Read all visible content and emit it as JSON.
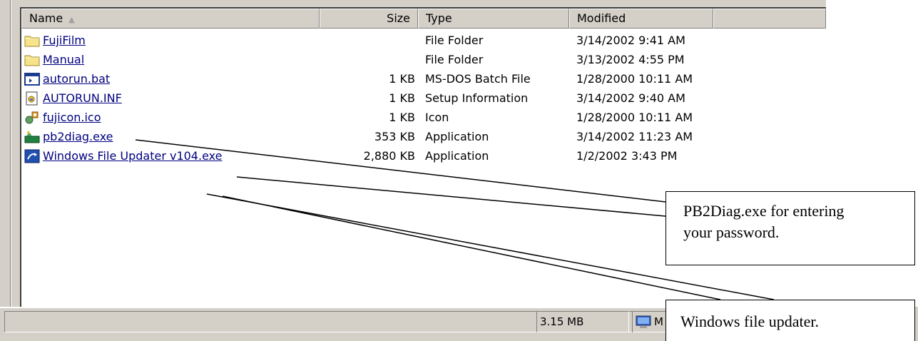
{
  "columns": {
    "name": "Name",
    "size": "Size",
    "type": "Type",
    "modified": "Modified"
  },
  "files": [
    {
      "icon": "folder-icon",
      "name": "FujiFilm",
      "size": "",
      "type": "File Folder",
      "modified": "3/14/2002 9:41 AM"
    },
    {
      "icon": "folder-icon",
      "name": "Manual",
      "size": "",
      "type": "File Folder",
      "modified": "3/13/2002 4:55 PM"
    },
    {
      "icon": "batch-file-icon",
      "name": "autorun.bat",
      "size": "1 KB",
      "type": "MS-DOS Batch File",
      "modified": "1/28/2000 10:11 AM"
    },
    {
      "icon": "setup-info-icon",
      "name": "AUTORUN.INF",
      "size": "1 KB",
      "type": "Setup Information",
      "modified": "3/14/2002 9:40 AM"
    },
    {
      "icon": "icon-file-icon",
      "name": "fujicon.ico",
      "size": "1 KB",
      "type": "Icon",
      "modified": "1/28/2000 10:11 AM"
    },
    {
      "icon": "application-icon",
      "name": "pb2diag.exe",
      "size": "353 KB",
      "type": "Application",
      "modified": "3/14/2002 11:23 AM"
    },
    {
      "icon": "updater-app-icon",
      "name": "Windows File Updater v104.exe",
      "size": "2,880 KB",
      "type": "Application",
      "modified": "1/2/2002 3:43 PM"
    }
  ],
  "status": {
    "total_size": "3.15 MB",
    "zone_text": "M"
  },
  "callouts": {
    "pb2diag_line1": "PB2Diag.exe for entering",
    "pb2diag_line2": "your password.",
    "updater": "Windows file updater."
  }
}
